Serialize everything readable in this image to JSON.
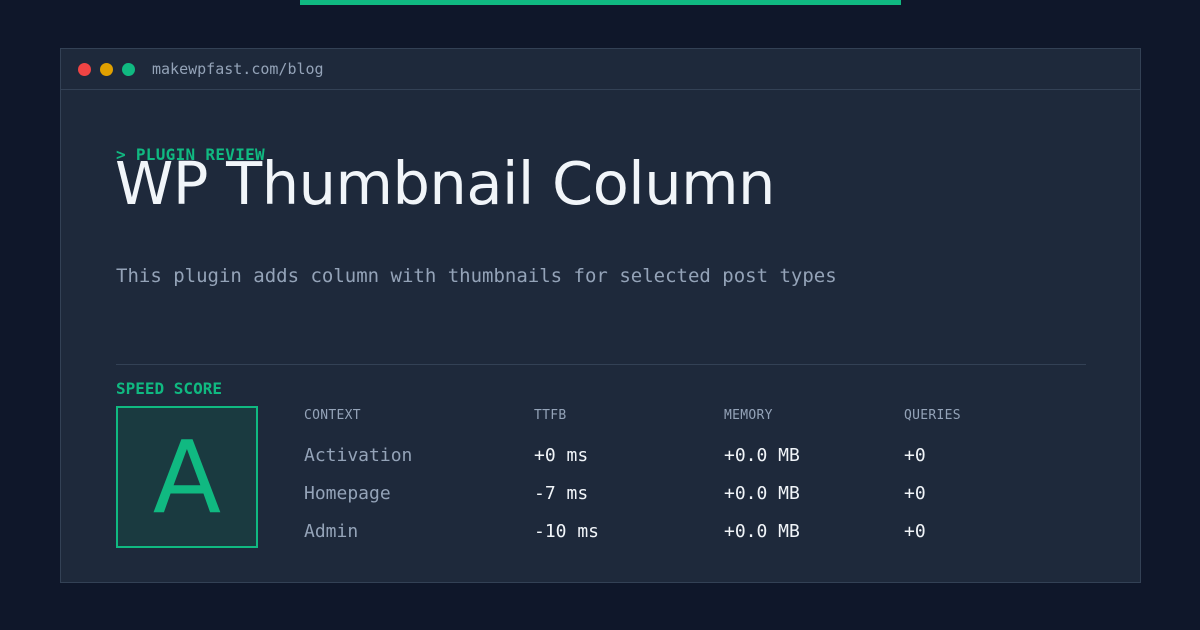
{
  "browser": {
    "url": "makewpfast.com/blog"
  },
  "article": {
    "kicker": "> PLUGIN REVIEW",
    "title": "WP Thumbnail Column",
    "description": "This plugin adds column with thumbnails for selected post types"
  },
  "speed": {
    "label": "SPEED SCORE",
    "grade": "A"
  },
  "table": {
    "headers": [
      "CONTEXT",
      "TTFB",
      "MEMORY",
      "QUERIES"
    ],
    "rows": [
      [
        "Activation",
        "+0 ms",
        "+0.0 MB",
        "+0"
      ],
      [
        "Homepage",
        "-7 ms",
        "+0.0 MB",
        "+0"
      ],
      [
        "Admin",
        "-10 ms",
        "+0.0 MB",
        "+0"
      ]
    ]
  },
  "colors": {
    "accent": "#10b981",
    "background": "#0f172a",
    "panel": "#1e293b"
  }
}
